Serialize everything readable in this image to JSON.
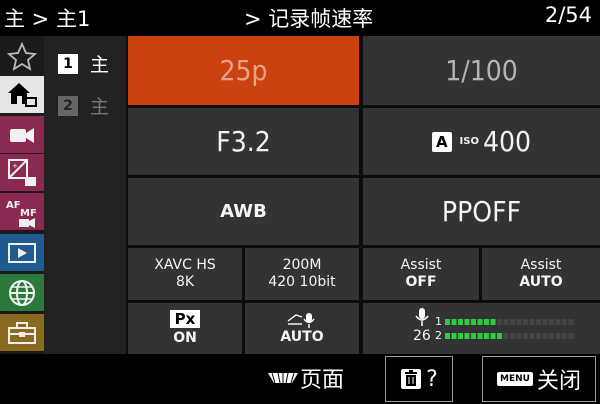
{
  "header": {
    "breadcrumb": "主 > 主1",
    "title": "> 记录帧速率",
    "page_indicator": "2/54"
  },
  "categories": [
    {
      "icon": "star-icon"
    },
    {
      "icon": "home-icon",
      "selected": true
    },
    {
      "icon": "camera-shoot-icon"
    },
    {
      "icon": "exposure-color-icon"
    },
    {
      "icon": "af-mf-icon"
    },
    {
      "icon": "playback-icon"
    },
    {
      "icon": "network-icon"
    },
    {
      "icon": "setup-toolbox-icon"
    }
  ],
  "pages": [
    {
      "number": "1",
      "label": "主",
      "selected": true
    },
    {
      "number": "2",
      "label": "主",
      "selected": false
    }
  ],
  "grid": {
    "frame_rate": "25p",
    "shutter": "1/100",
    "aperture": "F3.2",
    "iso_mode": "A",
    "iso_label": "ISO",
    "iso_value": "400",
    "white_balance": "AWB",
    "picture_profile": "PPOFF",
    "format_line1": "XAVC HS",
    "format_line2": "8K",
    "bitrate_line1": "200M",
    "bitrate_line2": "420 10bit",
    "assist1_label": "Assist",
    "assist1_value": "OFF",
    "assist2_label": "Assist",
    "assist2_value": "AUTO",
    "proxy_label": "Px",
    "proxy_value": "ON",
    "audio_value": "AUTO",
    "mic_level": "26",
    "channel1": "1",
    "channel2": "2",
    "meter_ch1": 0.4,
    "meter_ch2": 0.45
  },
  "footer": {
    "page_label": "页面",
    "help_label": "?",
    "menu_badge": "MENU",
    "close_label": "关闭"
  },
  "colors": {
    "selected_cell": "#cc4110",
    "meter_green": "#2ecc40"
  }
}
